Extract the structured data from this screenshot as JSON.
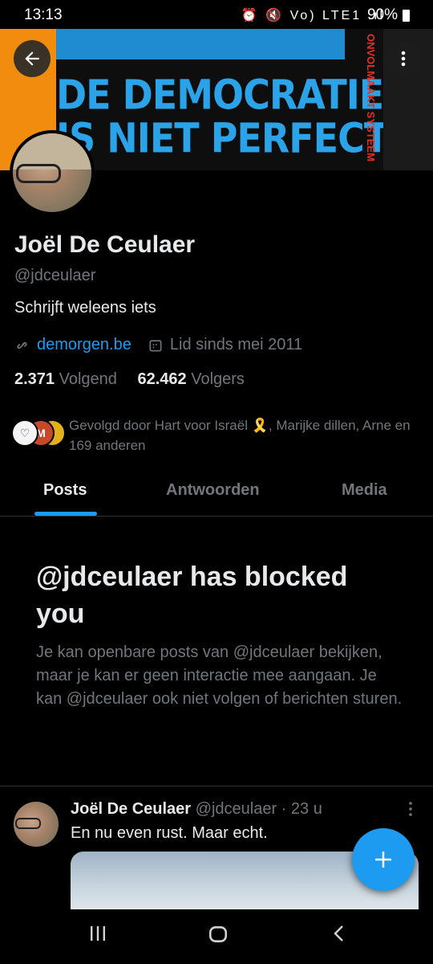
{
  "status_bar": {
    "time": "13:13",
    "icons": "⏰ 🔇 Vo) LTE1 .ıl",
    "battery": "90%"
  },
  "banner": {
    "line1": "DE DEMOCRATIE",
    "line2": "IS NIET PERFECT",
    "vertical_text": "ONVOLMAAKT SYSTEEM",
    "colors": {
      "orange": "#f28c0f",
      "blue_text": "#2aa3e8",
      "red_text": "#e2321f"
    }
  },
  "header": {
    "back_icon": "arrow-left-icon",
    "more_icon": "vertical-ellipsis-icon"
  },
  "profile": {
    "name": "Joël De Ceulaer",
    "handle": "@jdceulaer",
    "bio": "Schrijft weleens iets",
    "website": "demorgen.be",
    "joined": "Lid sinds mei 2011",
    "following_count": "2.371",
    "following_label": "Volgend",
    "followers_count": "62.462",
    "followers_label": "Volgers",
    "followed_by": "Gevolgd door Hart voor Israël 🎗️, Marijke dillen, Arne en 169 anderen"
  },
  "tabs": [
    {
      "label": "Posts",
      "active": true
    },
    {
      "label": "Antwoorden",
      "active": false
    },
    {
      "label": "Media",
      "active": false
    }
  ],
  "blocked": {
    "title": "@jdceulaer has blocked you",
    "body": "Je kan openbare posts van @jdceulaer bekijken, maar je kan er geen interactie mee aangaan. Je kan @jdceulaer ook niet volgen of berichten sturen."
  },
  "tweet": {
    "author_name": "Joël De Ceulaer",
    "author_handle": "@jdceulaer",
    "separator": "·",
    "time": "23 u",
    "text": "En nu even rust. Maar echt."
  },
  "colors": {
    "accent": "#1d9bf0",
    "secondary_text": "#71767b",
    "primary_text": "#e7e9ea",
    "divider": "#2f3336"
  }
}
